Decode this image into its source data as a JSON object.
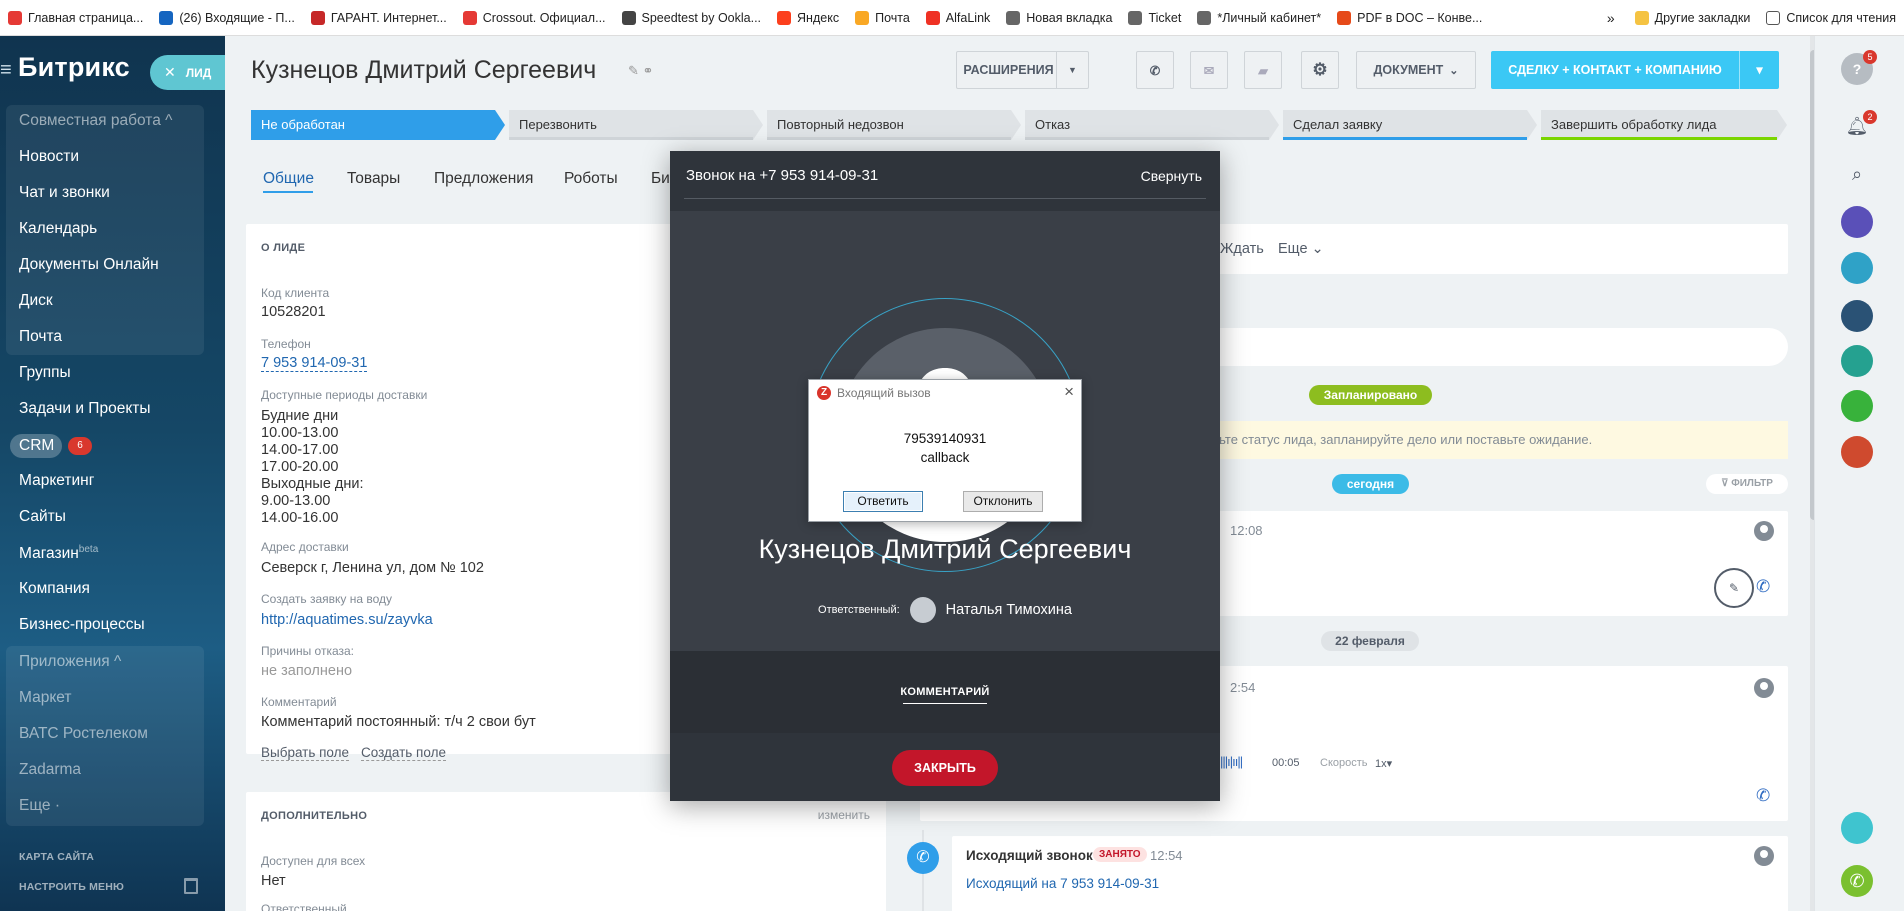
{
  "bookmarks": [
    {
      "label": "Главная страница...",
      "color": "#e53935"
    },
    {
      "label": "(26) Входящие - П...",
      "color": "#1565c0"
    },
    {
      "label": "ГАРАНТ. Интернет...",
      "color": "#c62828"
    },
    {
      "label": "Crossout. Официал...",
      "color": "#e53935"
    },
    {
      "label": "Speedtest by Ookla...",
      "color": "#444444"
    },
    {
      "label": "Яндекс",
      "color": "#fc3f1d"
    },
    {
      "label": "Почта",
      "color": "#f9a825"
    },
    {
      "label": "AlfaLink",
      "color": "#ef3124"
    },
    {
      "label": "Новая вкладка",
      "color": "#666666"
    },
    {
      "label": "Ticket",
      "color": "#666666"
    },
    {
      "label": "*Личный кабинет*",
      "color": "#666666"
    },
    {
      "label": "PDF в DOC – Конве...",
      "color": "#e64a19"
    }
  ],
  "bookmarks_right": {
    "more": "»",
    "other": "Другие закладки",
    "reading": "Список для чтения"
  },
  "sidebar": {
    "logo": "Битрикс",
    "lead_pill": "ЛИД",
    "items": {
      "collab": "Совместная работа ^",
      "news": "Новости",
      "chat": "Чат и звонки",
      "calendar": "Календарь",
      "docs": "Документы Онлайн",
      "disk": "Диск",
      "mail": "Почта",
      "groups": "Группы",
      "tasks": "Задачи и Проекты",
      "crm": "CRM",
      "crm_badge": "6",
      "marketing": "Маркетинг",
      "sites": "Сайты",
      "shop": "Магазин",
      "shop_sup": "beta",
      "company": "Компания",
      "bp": "Бизнес-процессы",
      "apps": "Приложения ^",
      "market": "Маркет",
      "vats": "ВАТС Ростелеком",
      "zadarma": "Zadarma",
      "more": "Еще ·",
      "sitemap": "КАРТА САЙТА",
      "settings": "НАСТРОИТЬ МЕНЮ"
    }
  },
  "header": {
    "title": "Кузнецов Дмитрий  Сергеевич",
    "extensions": "РАСШИРЕНИЯ",
    "document": "ДОКУМЕНТ",
    "deal": "СДЕЛКУ + КОНТАКТ + КОМПАНИЮ"
  },
  "stages": [
    {
      "label": "Не обработан",
      "color": "#2f9ee9"
    },
    {
      "label": "Перезвонить",
      "color": "#cfd4d8"
    },
    {
      "label": "Повторный недозвон",
      "color": "#cfd4d8"
    },
    {
      "label": "Отказ",
      "color": "#cfd4d8"
    },
    {
      "label": "Сделал заявку",
      "color": "#2f9ee9"
    },
    {
      "label": "Завершить обработку лида",
      "color": "#7bd500"
    }
  ],
  "tabs": [
    "Общие",
    "Товары",
    "Предложения",
    "Роботы",
    "Би"
  ],
  "lead": {
    "section": "О ЛИДЕ",
    "client_code_label": "Код клиента",
    "client_code": "10528201",
    "phone_label": "Телефон",
    "phone": "7 953 914-09-31",
    "periods_label": "Доступные периоды доставки",
    "periods": [
      "Будние дни",
      "10.00-13.00",
      "14.00-17.00",
      "17.00-20.00",
      "Выходные дни:",
      "9.00-13.00",
      "14.00-16.00"
    ],
    "address_label": "Адрес доставки",
    "address": "Северск г, Ленина ул, дом № 102",
    "order_label": "Создать заявку на воду",
    "order_link": "http://aquatimes.su/zayvka",
    "reasons_label": "Причины отказа:",
    "reasons": "не заполнено",
    "comment_label": "Комментарий",
    "comment": "Комментарий постоянный: т/ч 2 свои бут",
    "select_field": "Выбрать поле",
    "create_field": "Создать поле"
  },
  "extra": {
    "section": "ДОПОЛНИТЕЛЬНО",
    "change": "изменить",
    "available_label": "Доступен для всех",
    "available": "Нет",
    "resp_label": "Ответственный"
  },
  "timeline": {
    "wait": "Ждать",
    "more": "Еще",
    "planned": "Запланировано",
    "hint": "ньте статус лида, запланируйте дело или поставьте ожидание.",
    "today": "сегодня",
    "filter": "ФИЛЬТР",
    "time1": "12:08",
    "date2": "22 февраля",
    "time2": "2:54",
    "audio_time": "00:05",
    "speed_label": "Скорость",
    "speed": "1x",
    "out_title": "Исходящий звонок",
    "busy": "ЗАНЯТО",
    "time3": "12:54",
    "out_text": "Исходящий на 7 953 914-09-31"
  },
  "call": {
    "title": "Звонок на +7 953 914-09-31",
    "collapse": "Свернуть",
    "name": "Кузнецов Дмитрий Сергеевич",
    "resp_label": "Ответственный:",
    "resp_name": "Наталья Тимохина",
    "comment": "КОММЕНТАРИЙ",
    "close": "ЗАКРЫТЬ"
  },
  "dialog": {
    "title": "Входящий вызов",
    "number": "79539140931",
    "subtitle": "callback",
    "answer": "Ответить",
    "decline": "Отклонить"
  },
  "right_bar": {
    "notif_help": "5",
    "notif_bell": "2"
  }
}
